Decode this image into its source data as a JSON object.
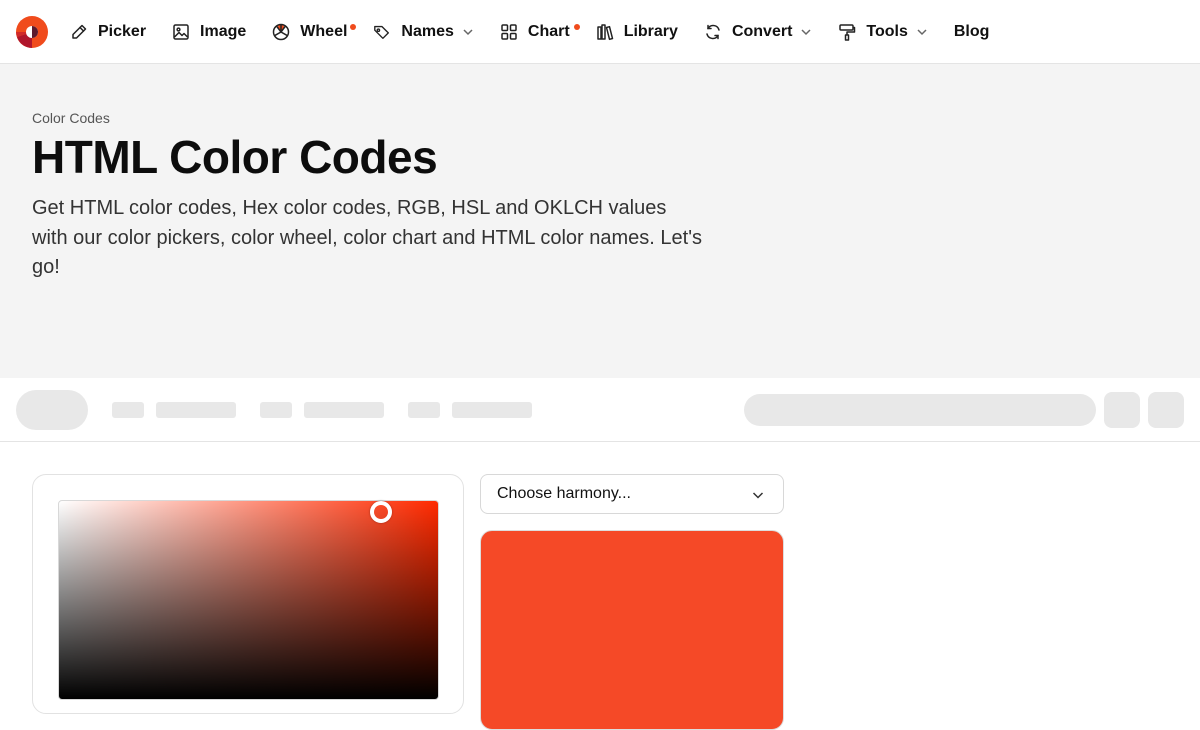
{
  "brand": {
    "accent": "#f04b1c",
    "logo_icon": "color-wheel-logo-icon"
  },
  "nav": {
    "items": [
      {
        "label": "Picker",
        "icon": "eyedropper-icon",
        "dot": false,
        "chevron": false
      },
      {
        "label": "Image",
        "icon": "image-icon",
        "dot": true,
        "chevron": false
      },
      {
        "label": "Wheel",
        "icon": "wheel-icon",
        "dot": true,
        "chevron": false
      },
      {
        "label": "Names",
        "icon": "tag-icon",
        "dot": false,
        "chevron": true
      },
      {
        "label": "Chart",
        "icon": "grid-icon",
        "dot": true,
        "chevron": false
      },
      {
        "label": "Library",
        "icon": "library-icon",
        "dot": false,
        "chevron": false
      },
      {
        "label": "Convert",
        "icon": "refresh-icon",
        "dot": false,
        "chevron": true
      },
      {
        "label": "Tools",
        "icon": "paint-roller-icon",
        "dot": false,
        "chevron": true
      },
      {
        "label": "Blog",
        "icon": "",
        "dot": false,
        "chevron": false
      }
    ]
  },
  "hero": {
    "breadcrumb": "Color Codes",
    "title": "HTML Color Codes",
    "subtitle": "Get HTML color codes, Hex color codes, RGB, HSL and OKLCH values with our color pickers, color wheel, color chart and HTML color names. Let's go!"
  },
  "picker": {
    "hue_color": "#ff2a00",
    "harmony_placeholder": "Choose harmony...",
    "swatch_color": "#f54927"
  }
}
